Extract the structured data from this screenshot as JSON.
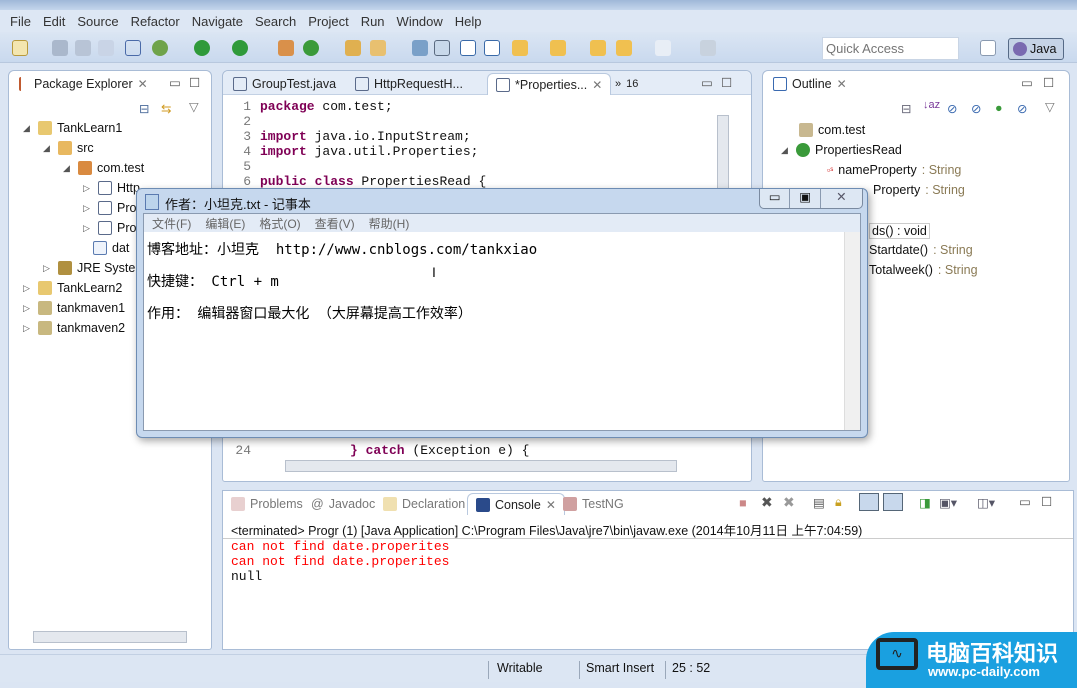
{
  "menu": [
    "File",
    "Edit",
    "Source",
    "Refactor",
    "Navigate",
    "Search",
    "Project",
    "Run",
    "Window",
    "Help"
  ],
  "toolbar": {
    "quick_access_placeholder": "Quick Access",
    "perspective": "Java"
  },
  "package_explorer": {
    "title": "Package Explorer",
    "items": [
      {
        "label": "TankLearn1",
        "icon": "project-icon"
      },
      {
        "label": "src",
        "icon": "source-folder-icon"
      },
      {
        "label": "com.test",
        "icon": "package-icon"
      },
      {
        "label": "Http",
        "icon": "java-file-icon"
      },
      {
        "label": "Pro",
        "icon": "java-file-icon"
      },
      {
        "label": "Pro",
        "icon": "java-file-icon"
      },
      {
        "label": "dat",
        "icon": "text-file-icon"
      },
      {
        "label": "JRE Syster",
        "icon": "library-icon"
      },
      {
        "label": "TankLearn2",
        "icon": "project-icon"
      },
      {
        "label": "tankmaven1",
        "icon": "maven-project-icon"
      },
      {
        "label": "tankmaven2",
        "icon": "maven-project-icon"
      }
    ]
  },
  "editor": {
    "tabs": [
      "GroupTest.java",
      "HttpRequestH...",
      "*Properties..."
    ],
    "overflow": "16",
    "lines": [
      {
        "n": "1",
        "kw": "package",
        "rest": " com.test;"
      },
      {
        "n": "2",
        "kw": "",
        "rest": ""
      },
      {
        "n": "3",
        "kw": "import",
        "rest": " java.io.InputStream;"
      },
      {
        "n": "4",
        "kw": "import",
        "rest": " java.util.Properties;"
      },
      {
        "n": "5",
        "kw": "",
        "rest": ""
      },
      {
        "n": "6",
        "kw": "public class",
        "rest": " PropertiesRead {"
      },
      {
        "n": "24",
        "kw": "} catch",
        "rest": " (Exception e) {"
      }
    ]
  },
  "outline": {
    "title": "Outline",
    "items": [
      {
        "label": "com.test",
        "type": ""
      },
      {
        "label": "PropertiesRead",
        "type": ""
      },
      {
        "label": "nameProperty",
        "type": " : String"
      },
      {
        "label": "Property",
        "type": " : String"
      },
      {
        "label": "ds() : void",
        "type": ""
      },
      {
        "label": "Startdate()",
        "type": " : String"
      },
      {
        "label": "Totalweek()",
        "type": " : String"
      }
    ]
  },
  "bottom": {
    "tabs": [
      "Problems",
      "Javadoc",
      "Declaration",
      "Console",
      "TestNG"
    ],
    "header": "<terminated> Progr (1) [Java Application] C:\\Program Files\\Java\\jre7\\bin\\javaw.exe (2014年10月11日 上午7:04:59)",
    "output": [
      "can not find date.properites",
      "can not find date.properites",
      "null"
    ],
    "error_color": "#ff0000"
  },
  "notepad": {
    "title": "作者：小坦克.txt - 记事本",
    "menu": [
      "文件(F)",
      "编辑(E)",
      "格式(O)",
      "查看(V)",
      "帮助(H)"
    ],
    "lines": [
      "博客地址：小坦克  http://www.cnblogs.com/tankxiao",
      "快捷键： Ctrl + m",
      "作用： 编辑器窗口最大化 （大屏幕提高工作效率）"
    ]
  },
  "status": {
    "writable": "Writable",
    "insert_mode": "Smart Insert",
    "position": "25 : 52"
  },
  "watermark": {
    "name": "电脑百科知识",
    "url": "www.pc-daily.com"
  }
}
